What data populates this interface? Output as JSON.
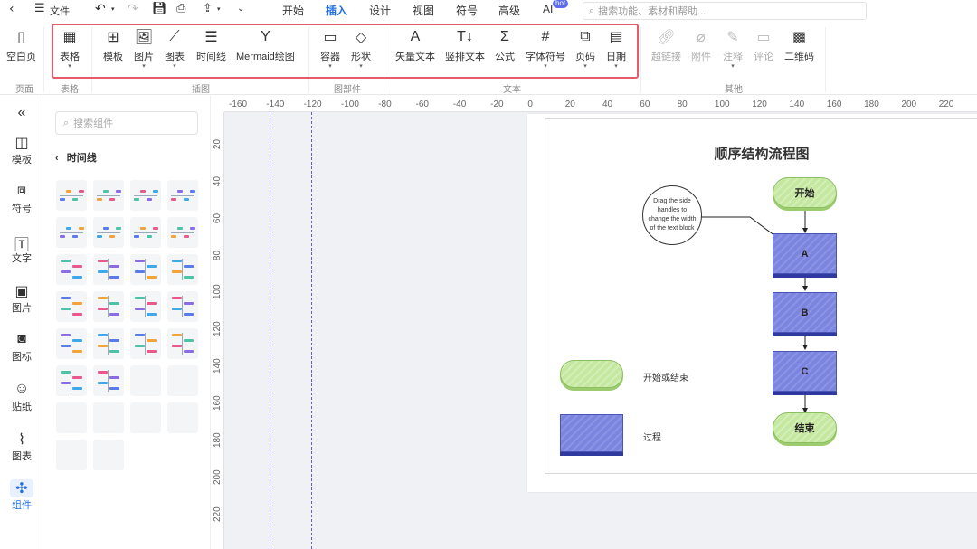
{
  "topbar": {
    "back_icon": "chevron-left-icon",
    "file_label": "文件",
    "tabs": [
      "开始",
      "插入",
      "设计",
      "视图",
      "符号",
      "高级",
      "AI"
    ],
    "active_tab": "插入",
    "ai_badge": "hot",
    "search_placeholder": "搜索功能、素材和帮助..."
  },
  "ribbon": {
    "blank_page": "空白页",
    "items": {
      "table": "表格",
      "template": "模板",
      "image": "图片",
      "chart": "图表",
      "timeline": "时间线",
      "mermaid": "Mermaid绘图",
      "container": "容器",
      "shape": "形状",
      "vector_text": "矢量文本",
      "vertical_text": "竖排文本",
      "formula": "公式",
      "font_symbol": "字体符号",
      "page_number": "页码",
      "date": "日期",
      "hyperlink": "超链接",
      "attachment": "附件",
      "annotation": "注释",
      "comment": "评论",
      "qrcode": "二维码"
    },
    "groups": {
      "page": "页面",
      "table": "表格",
      "illustration": "插图",
      "diagram_parts": "图部件",
      "text": "文本",
      "other": "其他"
    },
    "highlight_color": "#e85a6a"
  },
  "leftnav": {
    "collapse_icon": "double-chevron-left-icon",
    "items": [
      "模板",
      "符号",
      "文字",
      "图片",
      "图标",
      "贴纸",
      "图表",
      "组件"
    ],
    "active": "组件"
  },
  "panel": {
    "search_placeholder": "搜索组件",
    "section_title": "时间线"
  },
  "rulers": {
    "h_ticks": [
      "-160",
      "-140",
      "-120",
      "-100",
      "-80",
      "-60",
      "-40",
      "-20",
      "0",
      "20",
      "40",
      "60",
      "80",
      "100",
      "120",
      "140",
      "160",
      "180",
      "200",
      "220"
    ],
    "v_ticks": [
      "20",
      "40",
      "60",
      "80",
      "100",
      "120",
      "140",
      "160",
      "180",
      "200",
      "220"
    ]
  },
  "flowchart": {
    "title": "顺序结构流程图",
    "start": "开始",
    "steps": [
      "A",
      "B",
      "C"
    ],
    "end": "结束",
    "note": "Drag the side handles to change the width of the text block",
    "legend_terminal": "开始或结束",
    "legend_process": "过程",
    "colors": {
      "terminal_fill": "#c5e8a0",
      "process_fill": "#7b85e0",
      "accent": "#1f6fe5"
    }
  }
}
